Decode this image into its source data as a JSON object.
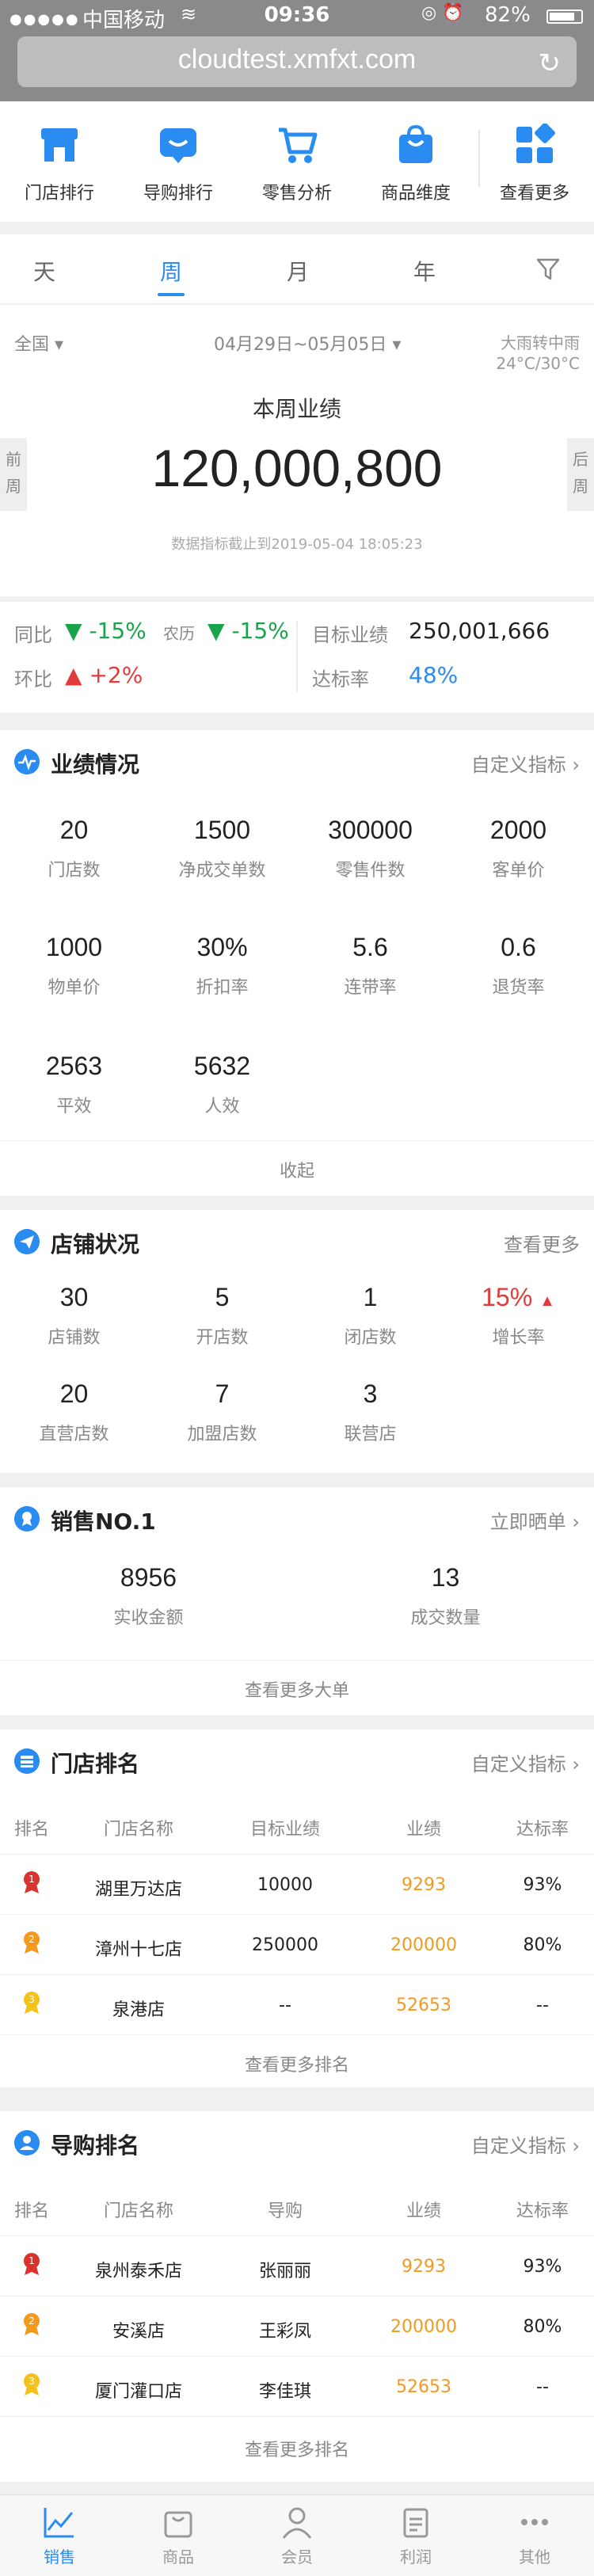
{
  "status_bar": {
    "carrier": "中国移动",
    "time": "09:36",
    "battery": "82%",
    "battery_level": 0.82
  },
  "browser": {
    "url": "cloudtest.xmfxt.com"
  },
  "quick_nav": [
    {
      "label": "门店排行",
      "icon": "store-icon"
    },
    {
      "label": "导购排行",
      "icon": "chat-icon"
    },
    {
      "label": "零售分析",
      "icon": "cart-icon"
    },
    {
      "label": "商品维度",
      "icon": "bag-icon"
    },
    {
      "label": "查看更多",
      "icon": "grid-icon"
    }
  ],
  "period_tabs": {
    "items": [
      "天",
      "周",
      "月",
      "年"
    ],
    "active": "周"
  },
  "summary": {
    "region": "全国",
    "date_range": "04月29日~05月05日",
    "weather": "大雨转中雨",
    "temperature": "24°C/30°C",
    "title": "本周业绩",
    "value": "120,000,800",
    "note": "数据指标截止到2019-05-04  18:05:23",
    "prev_label": "前周",
    "next_label": "后周"
  },
  "comparison": {
    "yoy_label": "同比",
    "yoy_value": "-15%",
    "lunar_label": "农历",
    "lunar_value": "-15%",
    "mom_label": "环比",
    "mom_value": "+2%",
    "target_label": "目标业绩",
    "target_value": "250,001,666",
    "rate_label": "达标率",
    "rate_value": "48%"
  },
  "performance": {
    "title": "业绩情况",
    "link": "自定义指标",
    "metrics": [
      {
        "value": "20",
        "label": "门店数"
      },
      {
        "value": "1500",
        "label": "净成交单数"
      },
      {
        "value": "300000",
        "label": "零售件数"
      },
      {
        "value": "2000",
        "label": "客单价"
      },
      {
        "value": "1000",
        "label": "物单价"
      },
      {
        "value": "30%",
        "label": "折扣率"
      },
      {
        "value": "5.6",
        "label": "连带率"
      },
      {
        "value": "0.6",
        "label": "退货率"
      },
      {
        "value": "2563",
        "label": "平效"
      },
      {
        "value": "5632",
        "label": "人效"
      }
    ],
    "footer": "收起"
  },
  "store_status": {
    "title": "店铺状况",
    "link": "查看更多",
    "metrics": [
      {
        "value": "30",
        "label": "店铺数"
      },
      {
        "value": "5",
        "label": "开店数"
      },
      {
        "value": "1",
        "label": "闭店数"
      },
      {
        "value": "15%",
        "label": "增长率"
      },
      {
        "value": "20",
        "label": "直营店数"
      },
      {
        "value": "7",
        "label": "加盟店数"
      },
      {
        "value": "3",
        "label": "联营店"
      }
    ]
  },
  "sales_top": {
    "title": "销售NO.1",
    "link": "立即晒单",
    "metrics": [
      {
        "value": "8956",
        "label": "实收金额"
      },
      {
        "value": "13",
        "label": "成交数量"
      }
    ],
    "footer": "查看更多大单"
  },
  "store_ranking": {
    "title": "门店排名",
    "link": "自定义指标",
    "headers": [
      "排名",
      "门店名称",
      "目标业绩",
      "业绩",
      "达标率"
    ],
    "rows": [
      {
        "name": "湖里万达店",
        "target": "10000",
        "perf": "9293",
        "rate": "93%"
      },
      {
        "name": "漳州十七店",
        "target": "250000",
        "perf": "200000",
        "rate": "80%"
      },
      {
        "name": "泉港店",
        "target": "--",
        "perf": "52653",
        "rate": "--"
      }
    ],
    "footer": "查看更多排名"
  },
  "guide_ranking": {
    "title": "导购排名",
    "link": "自定义指标",
    "headers": [
      "排名",
      "门店名称",
      "导购",
      "业绩",
      "达标率"
    ],
    "rows": [
      {
        "name": "泉州泰禾店",
        "guide": "张丽丽",
        "perf": "9293",
        "rate": "93%"
      },
      {
        "name": "安溪店",
        "guide": "王彩凤",
        "perf": "200000",
        "rate": "80%"
      },
      {
        "name": "厦门灌口店",
        "guide": "李佳琪",
        "perf": "52653",
        "rate": "--"
      }
    ],
    "footer": "查看更多排名"
  },
  "tab_bar": [
    {
      "label": "销售",
      "icon": "chart-icon",
      "active": true
    },
    {
      "label": "商品",
      "icon": "bag-icon",
      "active": false
    },
    {
      "label": "会员",
      "icon": "user-icon",
      "active": false
    },
    {
      "label": "利润",
      "icon": "clipboard-icon",
      "active": false
    },
    {
      "label": "其他",
      "icon": "more-icon",
      "active": false
    }
  ],
  "colors": {
    "accent": "#2a8cf0",
    "down_green": "#1aa34a",
    "up_red": "#e23b3b",
    "orange": "#f39a1e",
    "medal_red": "#d8332c",
    "medal_orange": "#f39a1e",
    "medal_yellow": "#f5c21b"
  }
}
